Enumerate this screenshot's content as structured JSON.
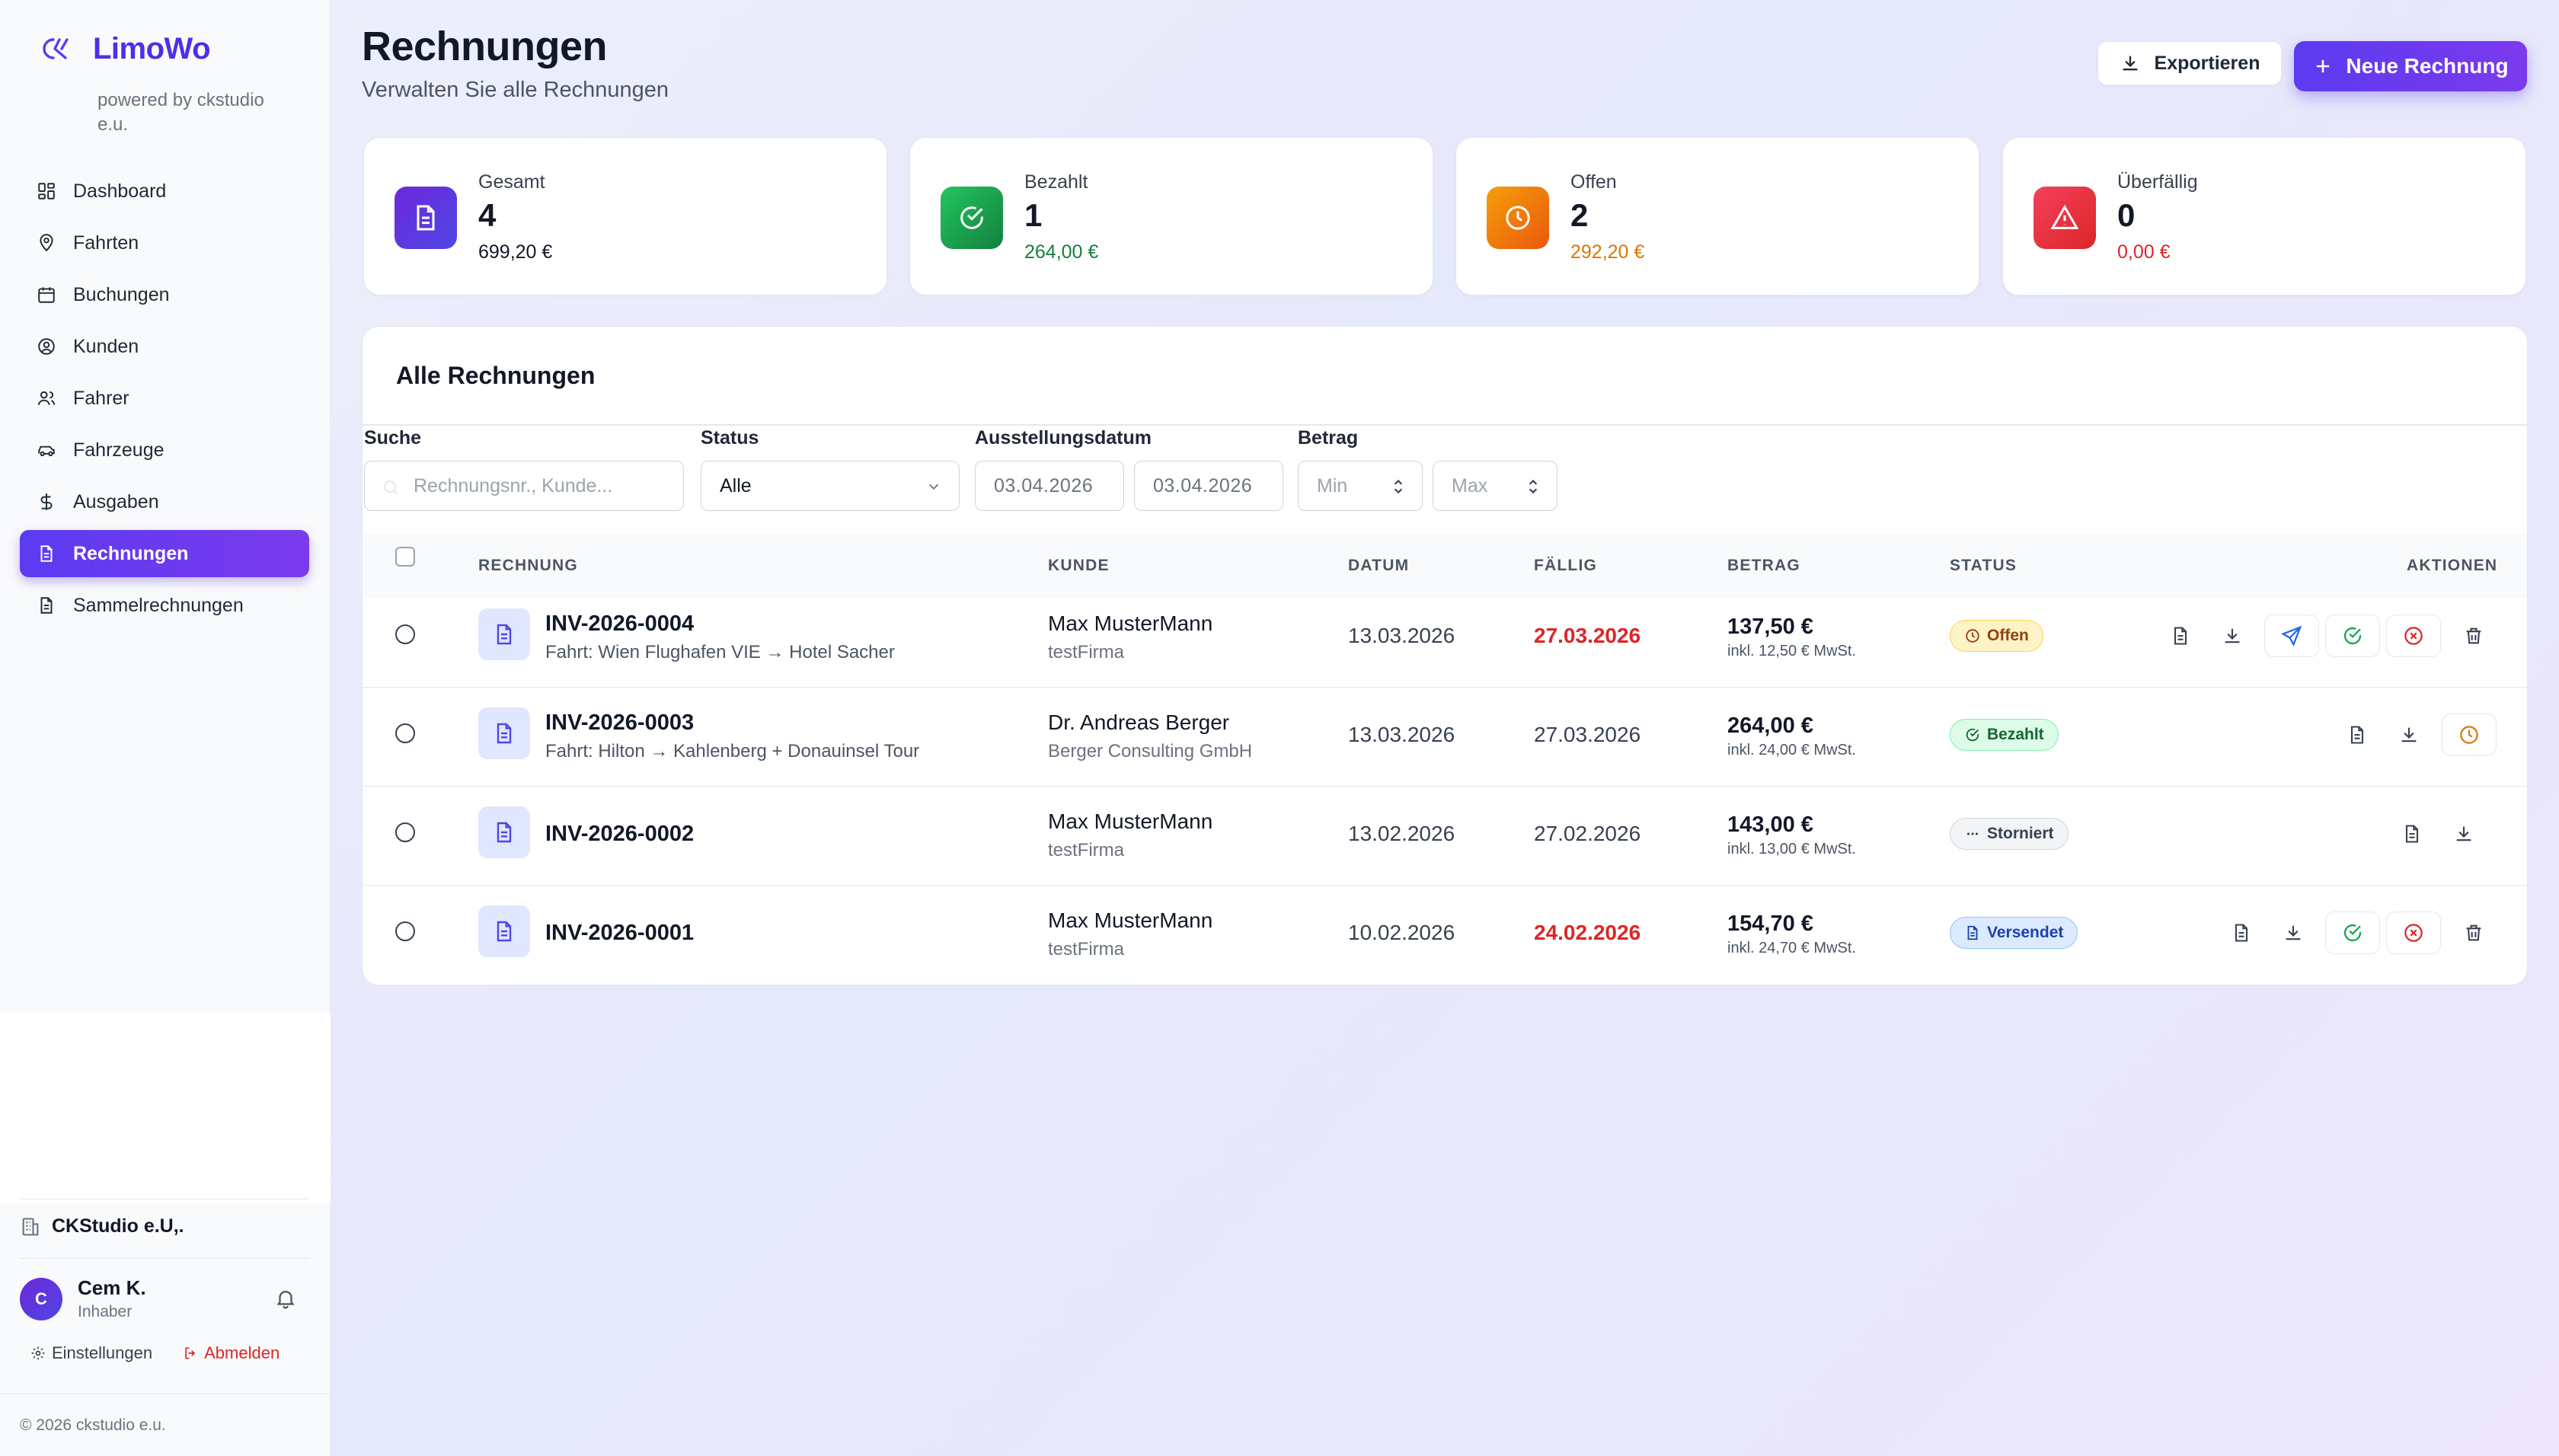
{
  "app": {
    "name": "LimoWo",
    "subtitle": "powered by ckstudio e.u.",
    "copyright": "© 2026 ckstudio e.u."
  },
  "sidebar": {
    "items": [
      {
        "label": "Dashboard",
        "icon": "grid-icon"
      },
      {
        "label": "Fahrten",
        "icon": "map-pin-icon"
      },
      {
        "label": "Buchungen",
        "icon": "calendar-icon"
      },
      {
        "label": "Kunden",
        "icon": "user-circle-icon"
      },
      {
        "label": "Fahrer",
        "icon": "users-icon"
      },
      {
        "label": "Fahrzeuge",
        "icon": "car-icon"
      },
      {
        "label": "Ausgaben",
        "icon": "dollar-icon"
      },
      {
        "label": "Rechnungen",
        "icon": "file-icon",
        "active": true
      },
      {
        "label": "Sammelrechnungen",
        "icon": "file-icon"
      }
    ],
    "company": "CKStudio e.U,.",
    "user": {
      "initial": "C",
      "name": "Cem K.",
      "role": "Inhaber"
    },
    "settings_label": "Einstellungen",
    "logout_label": "Abmelden"
  },
  "header": {
    "title": "Rechnungen",
    "subtitle": "Verwalten Sie alle Rechnungen",
    "export_label": "Exportieren",
    "new_label": "Neue Rechnung"
  },
  "stats": [
    {
      "label": "Gesamt",
      "count": "4",
      "amount": "699,20 €",
      "color": "#6d28d9",
      "amount_color": "#111827",
      "icon": "file-icon"
    },
    {
      "label": "Bezahlt",
      "count": "1",
      "amount": "264,00 €",
      "color": "#16a34a",
      "amount_color": "#15803d",
      "icon": "check-circle-icon"
    },
    {
      "label": "Offen",
      "count": "2",
      "amount": "292,20 €",
      "color": "#f59e0b",
      "amount_color": "#d97706",
      "icon": "clock-icon"
    },
    {
      "label": "Überfällig",
      "count": "0",
      "amount": "0,00 €",
      "color": "#e11d48",
      "amount_color": "#dc2626",
      "icon": "alert-triangle-icon"
    }
  ],
  "table": {
    "title": "Alle Rechnungen",
    "filters": {
      "search_label": "Suche",
      "search_placeholder": "Rechnungsnr., Kunde...",
      "status_label": "Status",
      "status_value": "Alle",
      "date_label": "Ausstellungsdatum",
      "date_from": "03.04.2026",
      "date_to": "03.04.2026",
      "amount_label": "Betrag",
      "amount_min": "Min",
      "amount_max": "Max"
    },
    "columns": [
      "RECHNUNG",
      "KUNDE",
      "DATUM",
      "FÄLLIG",
      "BETRAG",
      "STATUS",
      "AKTIONEN"
    ],
    "rows": [
      {
        "number": "INV-2026-0004",
        "desc": "Fahrt: Wien Flughafen VIE → Hotel Sacher",
        "customer": "Max MusterMann",
        "company": "testFirma",
        "date": "13.03.2026",
        "due": "27.03.2026",
        "overdue": true,
        "amount": "137,50 €",
        "vat": "inkl. 12,50 € MwSt.",
        "status": "Offen"
      },
      {
        "number": "INV-2026-0003",
        "desc": "Fahrt: Hilton → Kahlenberg + Donauinsel Tour",
        "customer": "Dr. Andreas Berger",
        "company": "Berger Consulting GmbH",
        "date": "13.03.2026",
        "due": "27.03.2026",
        "overdue": false,
        "amount": "264,00 €",
        "vat": "inkl. 24,00 € MwSt.",
        "status": "Bezahlt"
      },
      {
        "number": "INV-2026-0002",
        "desc": "",
        "customer": "Max MusterMann",
        "company": "testFirma",
        "date": "13.02.2026",
        "due": "27.02.2026",
        "overdue": false,
        "amount": "143,00 €",
        "vat": "inkl. 13,00 € MwSt.",
        "status": "Storniert"
      },
      {
        "number": "INV-2026-0001",
        "desc": "",
        "customer": "Max MusterMann",
        "company": "testFirma",
        "date": "10.02.2026",
        "due": "24.02.2026",
        "overdue": true,
        "amount": "154,70 €",
        "vat": "inkl. 24,70 € MwSt.",
        "status": "Versendet"
      }
    ]
  }
}
